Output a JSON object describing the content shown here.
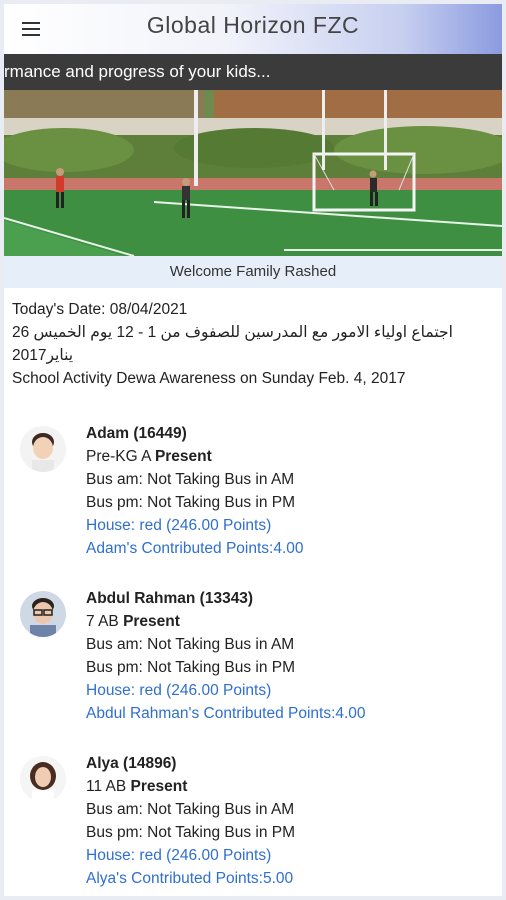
{
  "app": {
    "title": "Global Horizon FZC"
  },
  "ticker": {
    "text": "rmance and progress of your kids..."
  },
  "welcome": {
    "text": "Welcome Family Rashed"
  },
  "info": {
    "date_line": "Today's Date: 08/04/2021",
    "notice_arabic": "اجتماع اولياء الامور مع المدرسين للصفوف من 1 - 12 يوم الخميس 26 يناير2017",
    "notice_activity": "School Activity Dewa Awareness on Sunday Feb. 4, 2017"
  },
  "students": [
    {
      "name": "Adam (16449)",
      "class": "Pre-KG A",
      "status": "Present",
      "bus_am": "Bus am: Not Taking Bus in AM",
      "bus_pm": "Bus pm: Not Taking Bus in PM",
      "house": "House: red (246.00 Points)",
      "contrib": "Adam's Contributed Points:4.00"
    },
    {
      "name": "Abdul Rahman (13343)",
      "class": "7 AB",
      "status": "Present",
      "bus_am": "Bus am: Not Taking Bus in AM",
      "bus_pm": "Bus pm: Not Taking Bus in PM",
      "house": "House: red (246.00 Points)",
      "contrib": "Abdul Rahman's Contributed Points:4.00"
    },
    {
      "name": "Alya (14896)",
      "class": "11 AB",
      "status": "Present",
      "bus_am": "Bus am: Not Taking Bus in AM",
      "bus_pm": "Bus pm: Not Taking Bus in PM",
      "house": "House: red (246.00 Points)",
      "contrib": "Alya's Contributed Points:5.00"
    }
  ],
  "colors": {
    "link": "#2f6fcf",
    "ticker_bg": "#3b3b3b",
    "welcome_bg": "#e6eef9"
  }
}
